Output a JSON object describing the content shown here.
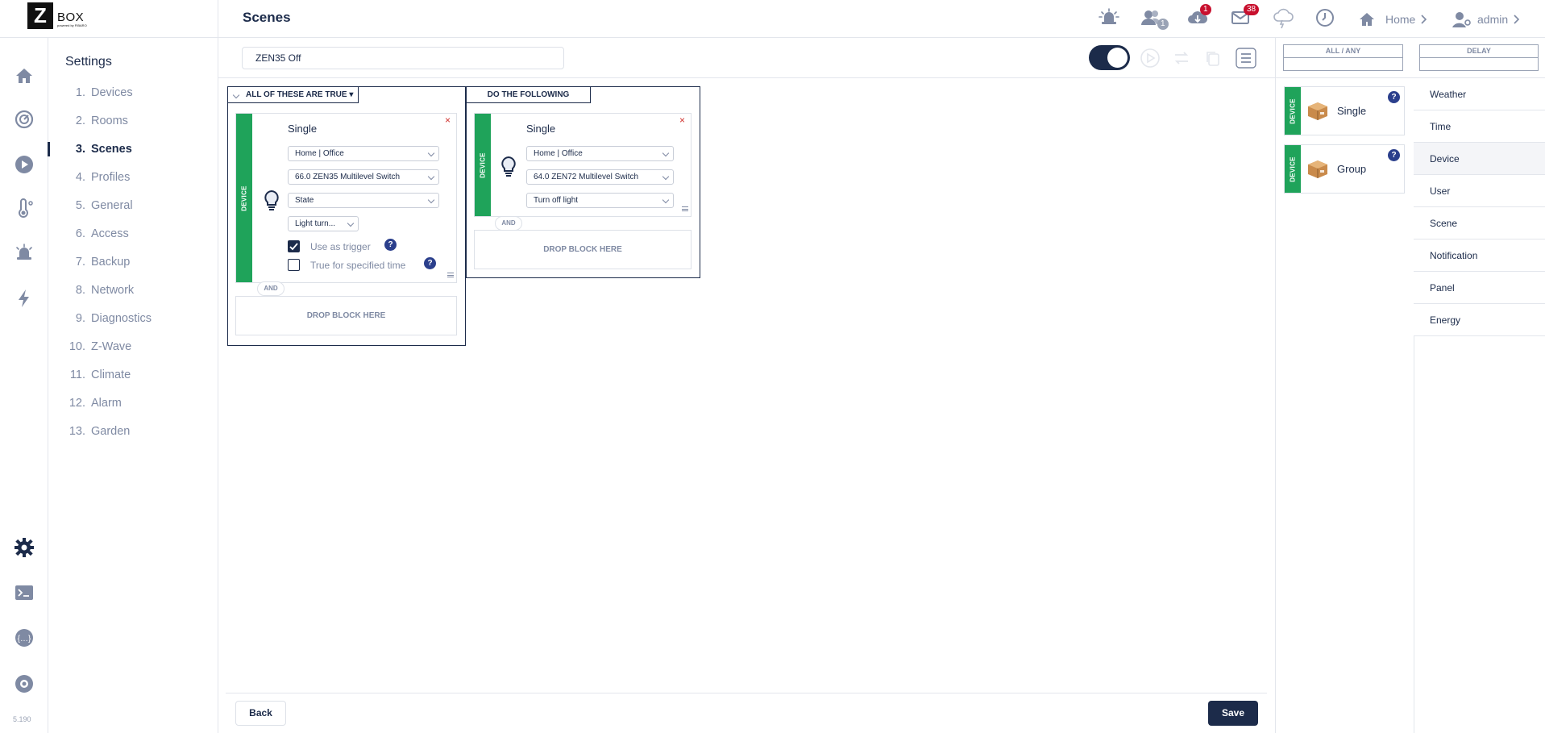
{
  "header": {
    "logo_letter": "Z",
    "logo_text": "BOX",
    "logo_subtext": "powered by FIBARO",
    "page_title": "Scenes",
    "users_badge": "1",
    "downloads_badge": "1",
    "messages_badge": "38",
    "home_label": "Home",
    "user_label": "admin"
  },
  "rail": {
    "version": "5.190"
  },
  "settings": {
    "title": "Settings",
    "items": [
      {
        "num": "1.",
        "label": "Devices"
      },
      {
        "num": "2.",
        "label": "Rooms"
      },
      {
        "num": "3.",
        "label": "Scenes"
      },
      {
        "num": "4.",
        "label": "Profiles"
      },
      {
        "num": "5.",
        "label": "General"
      },
      {
        "num": "6.",
        "label": "Access"
      },
      {
        "num": "7.",
        "label": "Backup"
      },
      {
        "num": "8.",
        "label": "Network"
      },
      {
        "num": "9.",
        "label": "Diagnostics"
      },
      {
        "num": "10.",
        "label": "Z-Wave"
      },
      {
        "num": "11.",
        "label": "Climate"
      },
      {
        "num": "12.",
        "label": "Alarm"
      },
      {
        "num": "13.",
        "label": "Garden"
      }
    ]
  },
  "scene": {
    "name": "ZEN35 Off",
    "enabled": true
  },
  "conditions": {
    "tab_label": "ALL OF THESE ARE TRUE",
    "card": {
      "type_label": "DEVICE",
      "title": "Single",
      "room": "Home | Office",
      "device": "66.0 ZEN35 Multilevel Switch",
      "property": "State",
      "value": "Light turn...",
      "use_as_trigger_label": "Use as trigger",
      "use_as_trigger": true,
      "true_for_time_label": "True for specified time",
      "true_for_time": false,
      "help": "?",
      "close": "×"
    },
    "and_label": "AND",
    "drop_label": "DROP BLOCK HERE"
  },
  "actions": {
    "tab_label": "DO THE FOLLOWING",
    "card": {
      "type_label": "DEVICE",
      "title": "Single",
      "room": "Home | Office",
      "device": "64.0 ZEN72 Multilevel Switch",
      "action": "Turn off light",
      "close": "×"
    },
    "and_label": "AND",
    "drop_label": "DROP BLOCK HERE"
  },
  "footer": {
    "back_label": "Back",
    "save_label": "Save"
  },
  "palette": {
    "all_any_label": "ALL / ANY",
    "delay_label": "DELAY",
    "blocks": [
      {
        "type_label": "DEVICE",
        "name": "Single",
        "help": "?"
      },
      {
        "type_label": "DEVICE",
        "name": "Group",
        "help": "?"
      }
    ],
    "categories": [
      {
        "label": "Weather"
      },
      {
        "label": "Time"
      },
      {
        "label": "Device"
      },
      {
        "label": "User"
      },
      {
        "label": "Scene"
      },
      {
        "label": "Notification"
      },
      {
        "label": "Panel"
      },
      {
        "label": "Energy"
      }
    ],
    "active_category": "Device"
  },
  "colors": {
    "navy": "#1c2b4a",
    "device_green": "#1fa35a",
    "badge_red": "#c8102e",
    "help_blue": "#2b3f8c",
    "muted": "#7f8aa3"
  }
}
